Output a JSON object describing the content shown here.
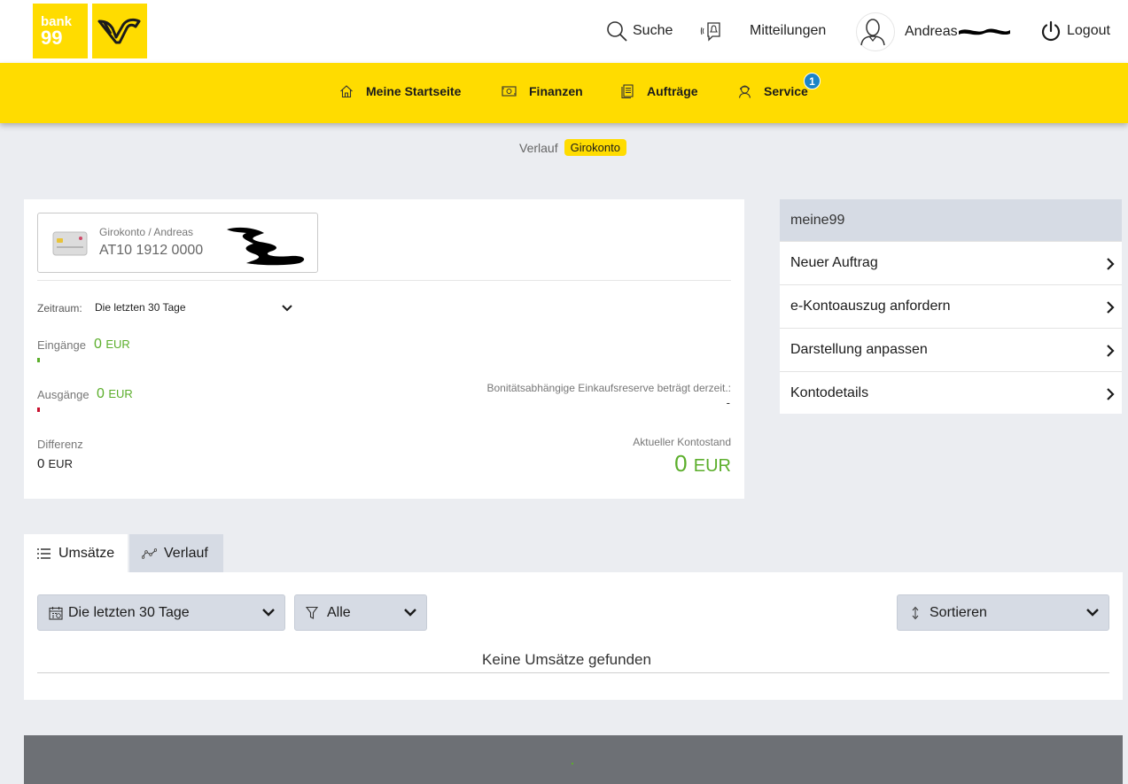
{
  "header": {
    "logo_bank": {
      "line1": "bank",
      "line2": "99"
    },
    "search_label": "Suche",
    "messages_label": "Mitteilungen",
    "user_name": "Andreas",
    "logout_label": "Logout"
  },
  "nav": {
    "items": [
      {
        "label": "Meine Startseite",
        "icon": "home-icon"
      },
      {
        "label": "Finanzen",
        "icon": "money-icon"
      },
      {
        "label": "Aufträge",
        "icon": "document-icon"
      },
      {
        "label": "Service",
        "icon": "service-icon",
        "badge": "1"
      }
    ],
    "accent": "#ffdc00",
    "badge_color": "#1c84c6"
  },
  "breadcrumb": {
    "previous": "Verlauf",
    "current": "Girokonto"
  },
  "account": {
    "name_label": "Girokonto / Andreas",
    "iban": "AT10 1912 0000",
    "period_label": "Zeitraum:",
    "period_value": "Die letzten 30 Tage",
    "incoming_label": "Eingänge",
    "incoming_value": "0",
    "incoming_currency": "EUR",
    "outgoing_label": "Ausgänge",
    "outgoing_value": "0",
    "outgoing_currency": "EUR",
    "difference_label": "Differenz",
    "difference_value": "0",
    "difference_currency": "EUR",
    "credit_reserve_label": "Bonitätsabhängige Einkaufsreserve beträgt derzeit.:",
    "credit_reserve_value": "-",
    "balance_label": "Aktueller Kontostand",
    "balance_value": "0",
    "balance_currency": "EUR",
    "positive_color": "#5bae2b",
    "negative_color": "#c8102e"
  },
  "sidebar": {
    "title": "meine99",
    "items": [
      {
        "label": "Neuer Auftrag"
      },
      {
        "label": "e-Kontoauszug anfordern"
      },
      {
        "label": "Darstellung anpassen"
      },
      {
        "label": "Kontodetails"
      }
    ]
  },
  "tabs": [
    {
      "label": "Umsätze",
      "icon": "list-icon",
      "active": true
    },
    {
      "label": "Verlauf",
      "icon": "line-chart-icon",
      "active": false
    }
  ],
  "transactions": {
    "date_filter": "Die letzten 30 Tage",
    "type_filter": "Alle",
    "sort_label": "Sortieren",
    "empty_text": "Keine Umsätze gefunden"
  }
}
